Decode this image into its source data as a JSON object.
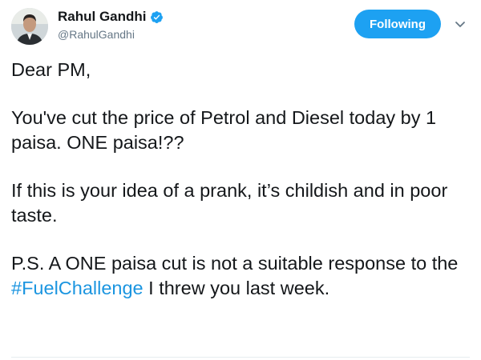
{
  "author": {
    "display_name": "Rahul Gandhi",
    "handle": "@RahulGandhi",
    "verified": true,
    "verified_color": "#1da1f2"
  },
  "actions": {
    "follow_label": "Following",
    "follow_color": "#1da1f2",
    "menu_icon": "chevron-down-icon"
  },
  "tweet": {
    "greeting": "Dear PM,",
    "para1": "You've cut the price of Petrol and Diesel today by 1 paisa. ONE paisa!??",
    "para2": "If this is your idea of a prank, it’s childish and in poor taste.",
    "para3_before": "P.S. A ONE paisa cut is not a suitable response to the ",
    "hashtag": "#FuelChallenge",
    "para3_after": " I threw you last week.",
    "hashtag_color": "#1b95e0"
  }
}
